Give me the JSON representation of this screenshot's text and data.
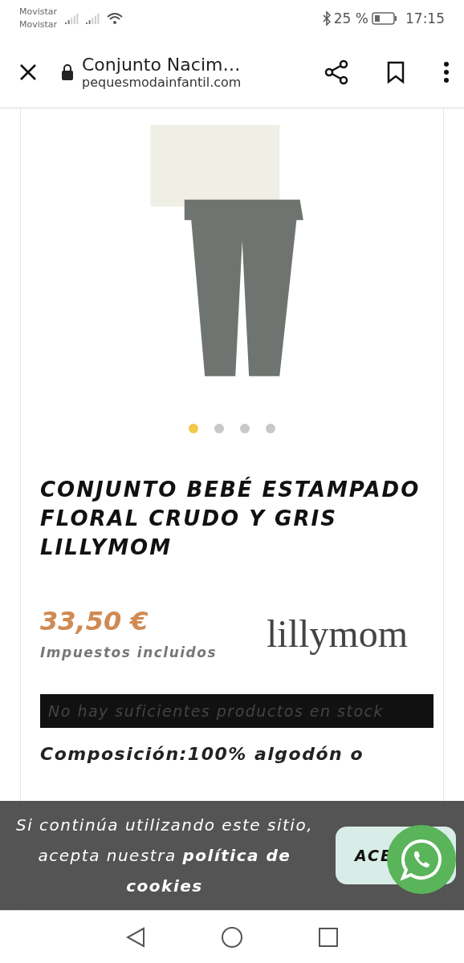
{
  "status_bar": {
    "carriers": [
      "Movistar",
      "Movistar"
    ],
    "battery": "25 %",
    "time": "17:15"
  },
  "browser_bar": {
    "title": "Conjunto Nacim…",
    "url": "pequesmodainfantil.com"
  },
  "carousel": {
    "dots": [
      {
        "selected": true
      },
      {
        "selected": false
      },
      {
        "selected": false
      },
      {
        "selected": false
      }
    ]
  },
  "product": {
    "title": "CONJUNTO BEBÉ ESTAMPADO FLORAL CRUDO Y GRIS LILLYMOM",
    "price": "33,50 €",
    "tax_note": "Impuestos incluidos",
    "brand_logo": "lillymom",
    "stock_notice": "No hay suficientes productos en stock",
    "composition": "Composición:100% algodón o"
  },
  "cookie_banner": {
    "message": "Si continúa utilizando este sitio, acepta nuestra **política de cookies**",
    "accept_button": "ACE"
  }
}
